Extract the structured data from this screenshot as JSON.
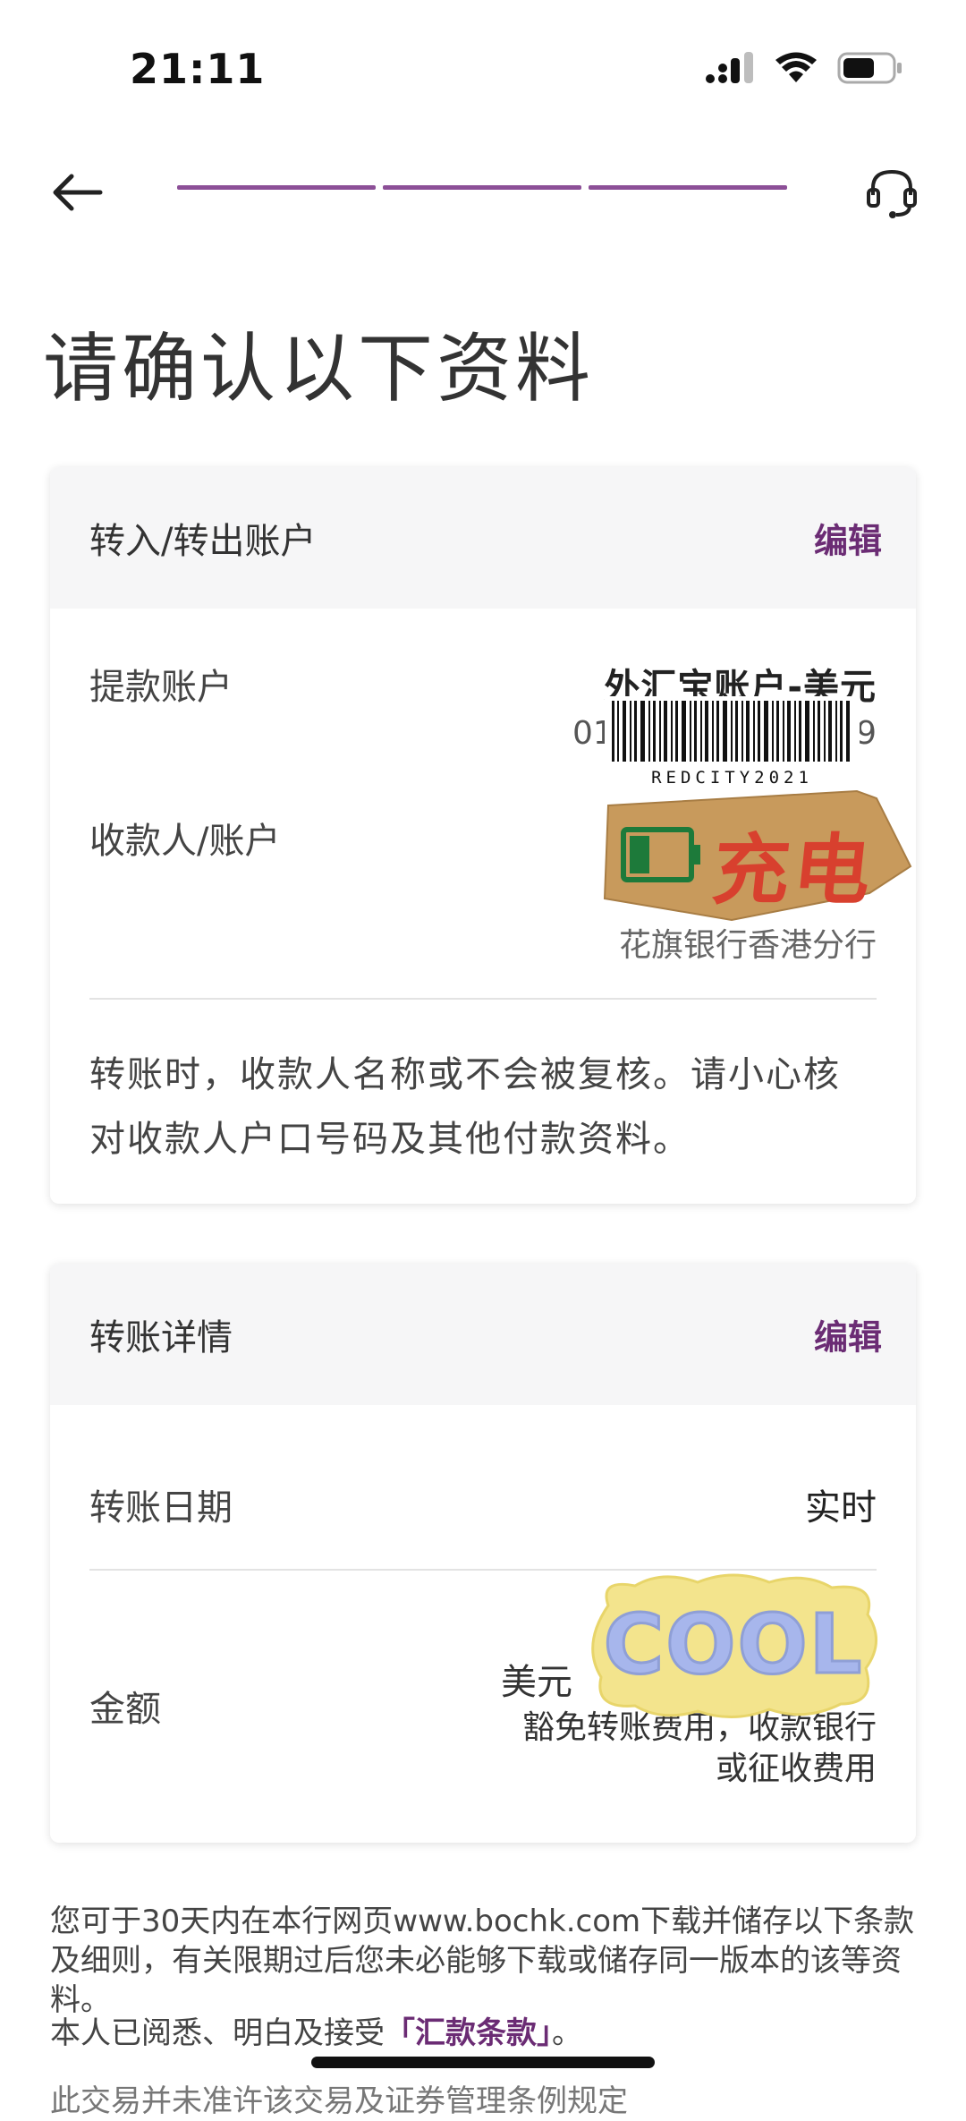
{
  "status_bar": {
    "time": "21:11"
  },
  "nav": {
    "progress_steps": 3,
    "progress_done": 3
  },
  "page_title": "请确认以下资料",
  "accounts_card": {
    "header": "转入/转出账户",
    "edit_label": "编辑",
    "withdraw_label": "提款账户",
    "withdraw_account_name": "外汇宝账户-美元",
    "withdraw_account_number_prefix": "01",
    "withdraw_account_number_suffix": "9",
    "payee_label": "收款人/账户",
    "payee_bank": "花旗银行香港分行",
    "warning": "转账时，收款人名称或不会被复核。请小心核对收款人户口号码及其他付款资料。"
  },
  "transfer_card": {
    "header": "转账详情",
    "edit_label": "编辑",
    "date_label": "转账日期",
    "date_value": "实时",
    "amount_label": "金额",
    "amount_currency": "美元",
    "fee_note_line1": "豁免转账费用，收款银行",
    "fee_note_line2": "或征收费用"
  },
  "stickers": {
    "barcode_caption": "REDCITY2021",
    "charge_text": "充电",
    "cool_text": "COOL"
  },
  "footer": {
    "notice": "您可于30天内在本行网页www.bochk.com下载并储存以下条款及细则，有关限期过后您未必能够下载或储存同一版本的该等资料。",
    "accept_prefix": "本人已阅悉、明白及接受",
    "terms_link": "「汇款条款」",
    "accept_suffix": "。",
    "cut_line": "此交易并未准许该交易及证券管理条例规定"
  },
  "colors": {
    "accent": "#6b2c74",
    "progress": "#8c4f97"
  }
}
